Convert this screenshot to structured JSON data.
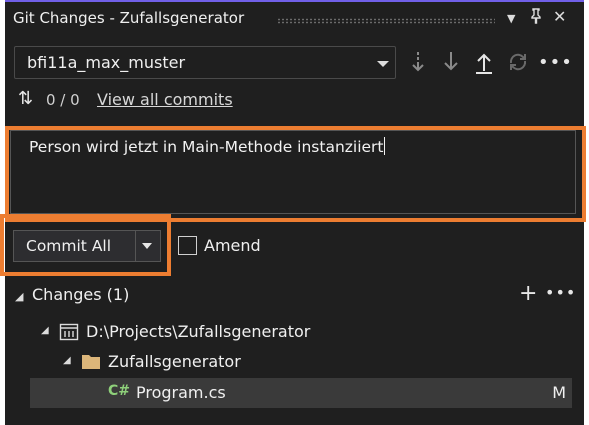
{
  "window": {
    "title": "Git Changes - Zufallsgenerator"
  },
  "branch": {
    "name": "bfi11a_max_muster"
  },
  "sync": {
    "count": "0 / 0",
    "view_all_label": "View all commits"
  },
  "commit": {
    "message": "Person wird jetzt in Main-Methode instanziiert",
    "button_label": "Commit All",
    "amend_label": "Amend",
    "amend_checked": false
  },
  "changes": {
    "header": "Changes (1)",
    "project_path": "D:\\Projects\\Zufallsgenerator",
    "folder": "Zufallsgenerator",
    "file": {
      "language_badge": "C#",
      "name": "Program.cs",
      "status": "M"
    }
  },
  "colors": {
    "accent": "#7160e8",
    "highlight": "#ed7d31",
    "csharp": "#8ed07a",
    "folder": "#dcb67a"
  }
}
